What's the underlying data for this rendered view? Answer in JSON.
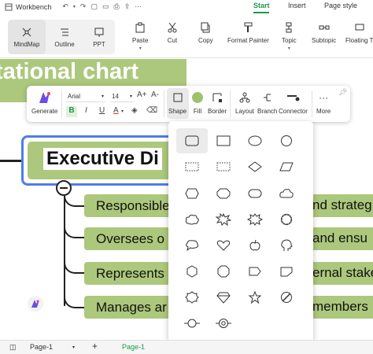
{
  "titlebar": {
    "app_name": "Workbench",
    "tabs": [
      {
        "label": "Start",
        "active": true
      },
      {
        "label": "Insert",
        "active": false
      },
      {
        "label": "Page style",
        "active": false
      }
    ]
  },
  "ribbon": {
    "views": [
      {
        "label": "MindMap",
        "icon": "mindmap-icon",
        "active": true
      },
      {
        "label": "Outline",
        "icon": "outline-icon",
        "active": false
      },
      {
        "label": "PPT",
        "icon": "ppt-icon",
        "active": false
      }
    ],
    "buttons": [
      {
        "label": "Paste",
        "icon": "paste-icon"
      },
      {
        "label": "Cut",
        "icon": "scissors-icon"
      },
      {
        "label": "Copy",
        "icon": "copy-icon"
      },
      {
        "label": "Format Painter",
        "icon": "format-painter-icon"
      },
      {
        "label": "Topic",
        "icon": "topic-icon"
      },
      {
        "label": "Subtopic",
        "icon": "subtopic-icon"
      },
      {
        "label": "Floating T",
        "icon": "floating-topic-icon"
      }
    ]
  },
  "canvas": {
    "title_text": "tational chart",
    "main_topic": "Executive Di",
    "subtopics": [
      {
        "left": "Responsible",
        "right": "nd strateg"
      },
      {
        "left": "Oversees o",
        "right": "and ensu"
      },
      {
        "left": "Represents",
        "right": "ernal stake"
      },
      {
        "left": "Manages ar",
        "right": "members"
      }
    ]
  },
  "float_toolbar": {
    "generate_label": "Generate",
    "font_name": "Arial",
    "font_size": "14",
    "grow_font": "A+",
    "shrink_font": "A-",
    "bold": "B",
    "italic": "I",
    "underline": "U",
    "font_color": "A",
    "shape_label": "Shape",
    "fill_label": "Fill",
    "border_label": "Border",
    "layout_label": "Layout",
    "branch_label": "Branch",
    "connector_label": "Connector",
    "more_label": "More",
    "fill_color": "#9dc26b"
  },
  "shape_panel": {
    "shapes": [
      "rounded-rectangle",
      "rectangle",
      "ellipse",
      "circle",
      "dotted-rectangle",
      "dotted-rectangle-2",
      "diamond",
      "parallelogram",
      "hexagon",
      "octagon-rounded",
      "capsule",
      "cloud",
      "cloud-2",
      "starburst",
      "burst",
      "scalloped-circle",
      "speech-blob",
      "heart",
      "apple",
      "head-profile",
      "hexagon-2",
      "octagon",
      "pentagon-arrow",
      "folded-corner",
      "flower",
      "gem",
      "star",
      "no-sign",
      "circle-line",
      "target-line"
    ],
    "selected": "rounded-rectangle"
  },
  "statusbar": {
    "page_select": "Page-1",
    "page_tab": "Page-1",
    "add_label": "+"
  },
  "colors": {
    "accent_green": "#1a9b4b",
    "node_green": "#acc87c",
    "selection_blue": "#4f7de8"
  }
}
